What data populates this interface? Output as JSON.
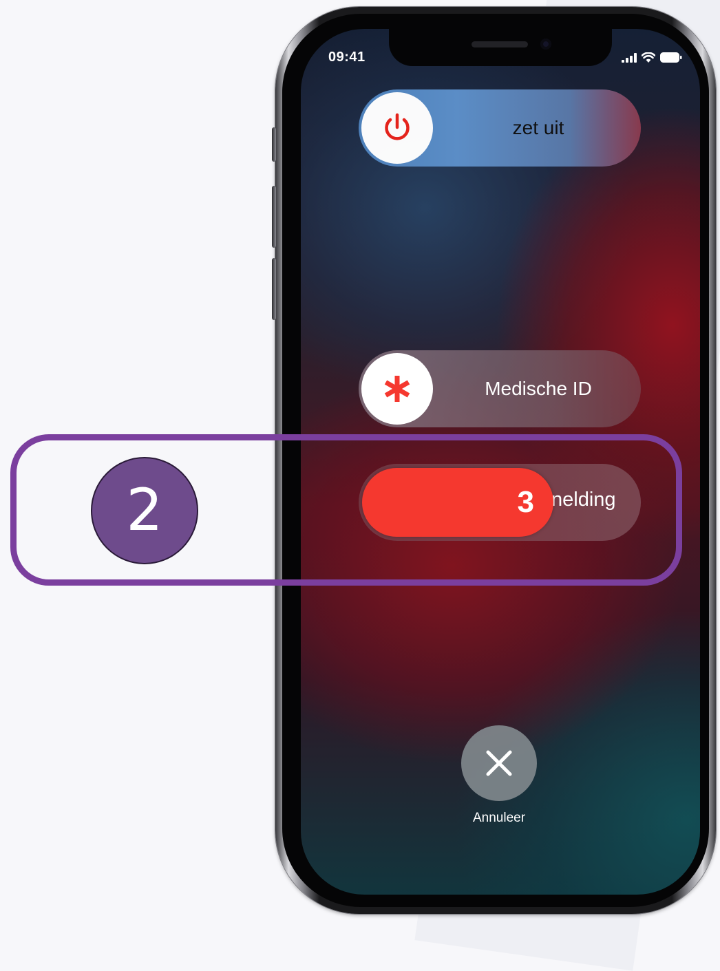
{
  "status_bar": {
    "time": "09:41",
    "icons": [
      "cellular-signal-icon",
      "wifi-icon",
      "battery-icon"
    ]
  },
  "sliders": {
    "power_off": {
      "label": "zet uit",
      "icon": "power-icon",
      "icon_color": "#e8231c"
    },
    "medical_id": {
      "label": "Medische ID",
      "icon": "asterisk-icon",
      "icon_color": "#f5382f"
    },
    "emergency_sos": {
      "track_label": "nelding",
      "countdown": "3",
      "fill_color": "#f5382f"
    }
  },
  "cancel": {
    "label": "Annuleer",
    "icon": "close-icon"
  },
  "annotation": {
    "step_number": "2",
    "highlight_color": "#7b3f9e",
    "badge_color": "#6e4b8c"
  }
}
